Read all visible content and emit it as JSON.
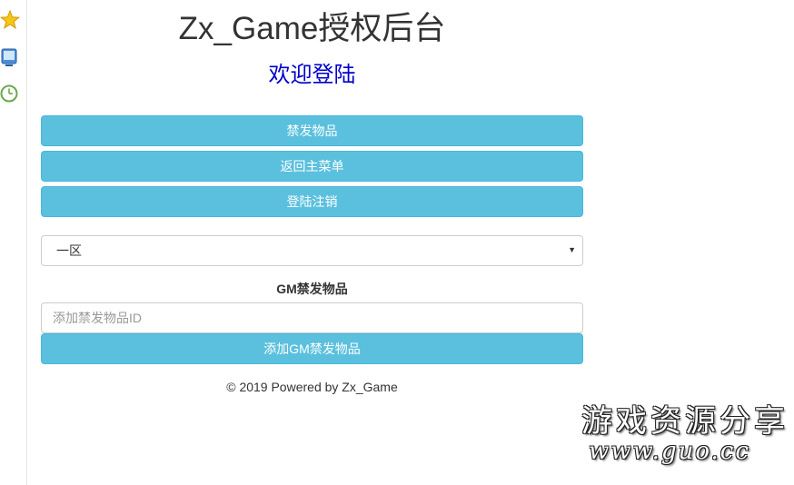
{
  "sidebar": {
    "icons": [
      "star-icon",
      "monitor-icon",
      "clock-icon"
    ]
  },
  "header": {
    "title": "Zx_Game授权后台",
    "subtitle": "欢迎登陆"
  },
  "buttons": {
    "banned_items": "禁发物品",
    "back_to_menu": "返回主菜单",
    "logout": "登陆注销"
  },
  "server_select": {
    "selected": "一区"
  },
  "gm_section": {
    "label": "GM禁发物品",
    "input_placeholder": "添加禁发物品ID",
    "add_button": "添加GM禁发物品"
  },
  "footer": {
    "text": "© 2019 Powered by Zx_Game"
  },
  "watermark": {
    "line1": "游戏资源分享",
    "line2": "www.guo.cc"
  },
  "colors": {
    "button_bg": "#5bc0de",
    "subtitle": "#0000cc",
    "title": "#333333"
  }
}
